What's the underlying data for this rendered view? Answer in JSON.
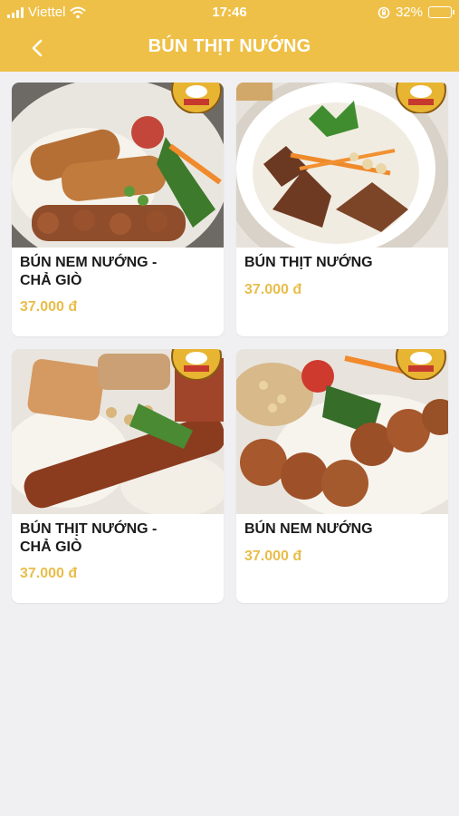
{
  "status_bar": {
    "carrier": "Viettel",
    "time": "17:46",
    "battery": "32%",
    "battery_level": 0.32,
    "icons": [
      "signal-icon",
      "wifi-icon",
      "rotation-lock-icon",
      "battery-icon"
    ]
  },
  "header": {
    "title": "BÚN THỊT NƯỚNG",
    "back_icon": "chevron-left-icon"
  },
  "colors": {
    "header_bg": "#efc047",
    "price": "#e9bd4a",
    "page_bg": "#f0f0f3"
  },
  "products": [
    {
      "name_line1": "BÚN NEM NƯỚNG -",
      "name_line2": "CHẢ GIÒ",
      "price": "37.000 đ"
    },
    {
      "name_line1": "BÚN THỊT NƯỚNG",
      "name_line2": "",
      "price": "37.000 đ"
    },
    {
      "name_line1": "BÚN THỊT NƯỚNG -",
      "name_line2": "CHẢ GIÒ",
      "price": "37.000 đ"
    },
    {
      "name_line1": "BÚN NEM NƯỚNG",
      "name_line2": "",
      "price": "37.000 đ"
    }
  ]
}
